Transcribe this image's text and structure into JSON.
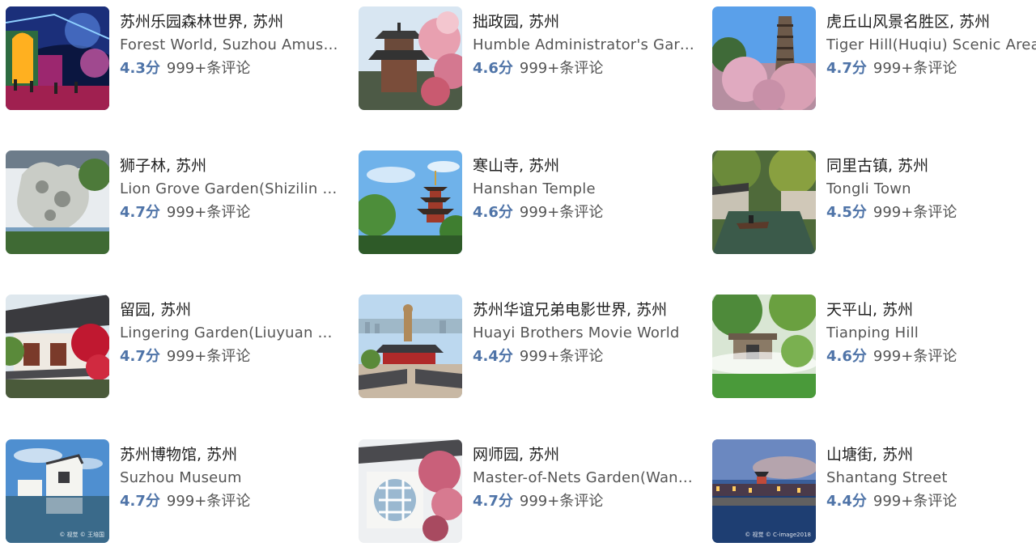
{
  "attractions": [
    {
      "title": "苏州乐园森林世界, 苏州",
      "subtitle": "Forest World, Suzhou Amusement Park",
      "score": "4.3分",
      "reviews": "999+条评论"
    },
    {
      "title": "拙政园, 苏州",
      "subtitle": "Humble Administrator's Garden",
      "score": "4.6分",
      "reviews": "999+条评论"
    },
    {
      "title": "虎丘山风景名胜区, 苏州",
      "subtitle": "Tiger Hill(Huqiu) Scenic Area",
      "score": "4.7分",
      "reviews": "999+条评论"
    },
    {
      "title": "狮子林, 苏州",
      "subtitle": "Lion Grove Garden(Shizilin Garden)",
      "score": "4.7分",
      "reviews": "999+条评论"
    },
    {
      "title": "寒山寺, 苏州",
      "subtitle": "Hanshan Temple",
      "score": "4.6分",
      "reviews": "999+条评论"
    },
    {
      "title": "同里古镇, 苏州",
      "subtitle": "Tongli Town",
      "score": "4.5分",
      "reviews": "999+条评论"
    },
    {
      "title": "留园, 苏州",
      "subtitle": "Lingering Garden(Liuyuan Garden)",
      "score": "4.7分",
      "reviews": "999+条评论"
    },
    {
      "title": "苏州华谊兄弟电影世界, 苏州",
      "subtitle": "Huayi Brothers Movie World",
      "score": "4.4分",
      "reviews": "999+条评论"
    },
    {
      "title": "天平山, 苏州",
      "subtitle": "Tianping Hill",
      "score": "4.6分",
      "reviews": "999+条评论"
    },
    {
      "title": "苏州博物馆, 苏州",
      "subtitle": "Suzhou Museum",
      "score": "4.7分",
      "reviews": "999+条评论"
    },
    {
      "title": "网师园, 苏州",
      "subtitle": "Master-of-Nets Garden(Wangshi Garden)",
      "score": "4.7分",
      "reviews": "999+条评论"
    },
    {
      "title": "山塘街, 苏州",
      "subtitle": "Shantang Street",
      "score": "4.4分",
      "reviews": "999+条评论"
    }
  ],
  "watermarks": {
    "museum": "© 视觉 © 王培国",
    "shantang": "© 视觉 © C-image2018"
  },
  "colors": {
    "score": "#4f74a8",
    "title": "#222222",
    "subtitle": "#555555"
  }
}
